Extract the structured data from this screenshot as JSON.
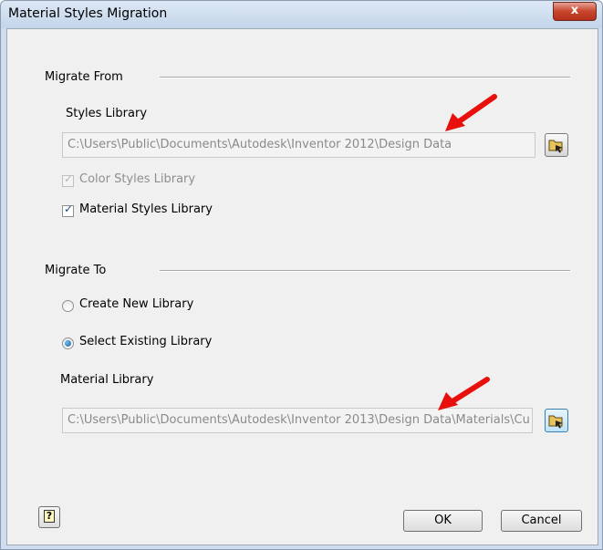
{
  "window": {
    "title": "Material Styles Migration",
    "close_glyph": "x"
  },
  "migrate_from": {
    "section_label": "Migrate From",
    "styles_library_label": "Styles Library",
    "styles_library_path": "C:\\Users\\Public\\Documents\\Autodesk\\Inventor 2012\\Design Data",
    "color_styles": {
      "label": "Color Styles Library",
      "checked": true,
      "enabled": false
    },
    "material_styles": {
      "label": "Material Styles Library",
      "checked": true,
      "enabled": true
    }
  },
  "migrate_to": {
    "section_label": "Migrate To",
    "create_new": {
      "label": "Create New Library",
      "selected": false
    },
    "select_existing": {
      "label": "Select Existing Library",
      "selected": true
    },
    "material_library_label": "Material Library",
    "material_library_path": "C:\\Users\\Public\\Documents\\Autodesk\\Inventor 2013\\Design Data\\Materials\\Cu"
  },
  "footer": {
    "help_glyph": "?",
    "ok_label": "OK",
    "cancel_label": "Cancel"
  },
  "icons": {
    "browse": "folder-browse-icon",
    "help": "help-icon",
    "annotation": "red-arrow-icon"
  },
  "colors": {
    "annotation_arrow": "#e8100c",
    "title_bar": "#c3d5ea",
    "close_button": "#c8442c"
  }
}
